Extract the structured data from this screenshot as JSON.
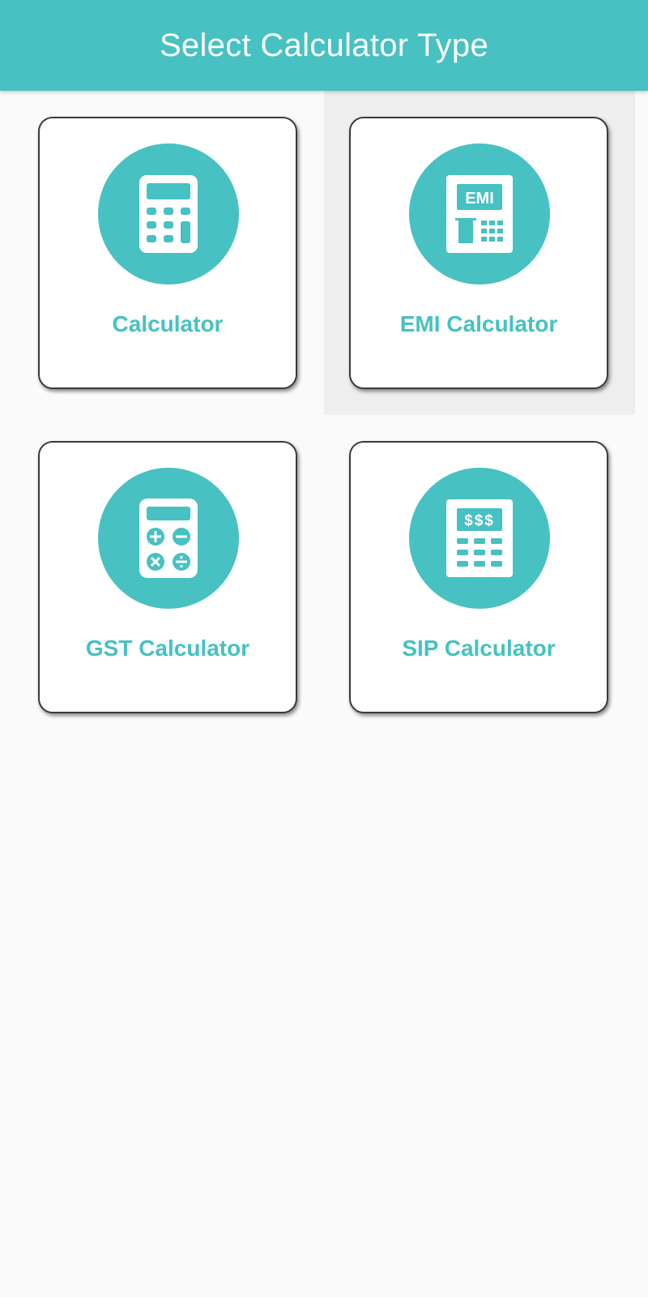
{
  "header": {
    "title": "Select Calculator Type"
  },
  "theme": {
    "accent": "#47c1c1",
    "background": "#fafafa",
    "card": "#ffffff"
  },
  "calculators": [
    {
      "label": "Calculator",
      "icon": "calculator-icon"
    },
    {
      "label": "EMI Calculator",
      "icon": "emi-calculator-icon",
      "icon_text": "EMI"
    },
    {
      "label": "GST Calculator",
      "icon": "gst-calculator-icon"
    },
    {
      "label": "SIP Calculator",
      "icon": "sip-calculator-icon",
      "icon_text": "$$$"
    }
  ]
}
